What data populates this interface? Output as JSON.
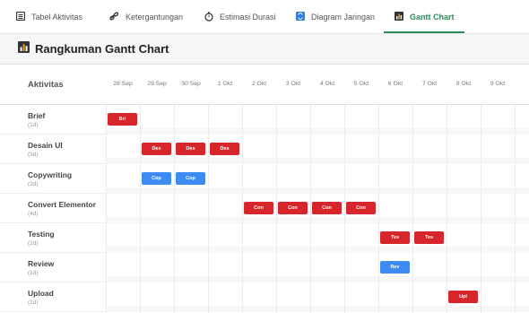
{
  "tabs": [
    {
      "label": "Tabel Aktivitas",
      "icon": "table-icon"
    },
    {
      "label": "Ketergantungan",
      "icon": "link-icon"
    },
    {
      "label": "Estimasi Durasi",
      "icon": "stopwatch-icon"
    },
    {
      "label": "Diagram Jaringan",
      "icon": "network-icon"
    },
    {
      "label": "Gantt Chart",
      "icon": "bar-chart-icon",
      "active": true
    }
  ],
  "summary": {
    "title": "Rangkuman Gantt Chart",
    "icon": "bar-chart-icon"
  },
  "table": {
    "activity_header": "Aktivitas",
    "dates": [
      "28 Sep",
      "29 Sep",
      "30 Sep",
      "1 Okt",
      "2 Okt",
      "3 Okt",
      "4 Okt",
      "5 Okt",
      "6 Okt",
      "7 Okt",
      "8 Okt",
      "9 Okt"
    ]
  },
  "colors": {
    "accent": "#2e8b57",
    "red": "#d7262b",
    "blue": "#3d8bf2"
  },
  "activities": [
    {
      "name": "Brief",
      "duration": "(1d)",
      "color": "red",
      "bars": [
        {
          "day": 0,
          "label": "Bri"
        }
      ]
    },
    {
      "name": "Desain UI",
      "duration": "(3d)",
      "color": "red",
      "bars": [
        {
          "day": 1,
          "label": "Des"
        },
        {
          "day": 2,
          "label": "Des"
        },
        {
          "day": 3,
          "label": "Des"
        }
      ]
    },
    {
      "name": "Copywriting",
      "duration": "(2d)",
      "color": "blue",
      "bars": [
        {
          "day": 1,
          "label": "Cop"
        },
        {
          "day": 2,
          "label": "Cop"
        }
      ]
    },
    {
      "name": "Convert Elementor",
      "duration": "(4d)",
      "color": "red",
      "bars": [
        {
          "day": 4,
          "label": "Con"
        },
        {
          "day": 5,
          "label": "Con"
        },
        {
          "day": 6,
          "label": "Con"
        },
        {
          "day": 7,
          "label": "Con"
        }
      ]
    },
    {
      "name": "Testing",
      "duration": "(2d)",
      "color": "red",
      "bars": [
        {
          "day": 8,
          "label": "Tes"
        },
        {
          "day": 9,
          "label": "Tes"
        }
      ]
    },
    {
      "name": "Review",
      "duration": "(1d)",
      "color": "blue",
      "bars": [
        {
          "day": 8,
          "label": "Rev"
        }
      ]
    },
    {
      "name": "Upload",
      "duration": "(1d)",
      "color": "red",
      "bars": [
        {
          "day": 10,
          "label": "Upl"
        }
      ]
    }
  ]
}
